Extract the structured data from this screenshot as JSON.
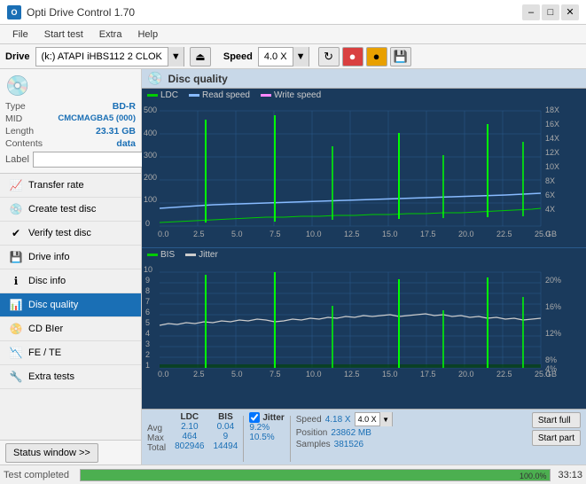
{
  "titleBar": {
    "title": "Opti Drive Control 1.70",
    "minimizeLabel": "–",
    "maximizeLabel": "□",
    "closeLabel": "✕"
  },
  "menuBar": {
    "items": [
      "File",
      "Start test",
      "Extra",
      "Help"
    ]
  },
  "driveBar": {
    "driveLabel": "Drive",
    "driveValue": "(k:) ATAPI iHBS112  2 CLOK",
    "speedLabel": "Speed",
    "speedValue": "4.0 X",
    "ejectIcon": "⏏"
  },
  "disc": {
    "type_label": "Type",
    "type_value": "BD-R",
    "mid_label": "MID",
    "mid_value": "CMCMAGBA5 (000)",
    "length_label": "Length",
    "length_value": "23.31 GB",
    "contents_label": "Contents",
    "contents_value": "data",
    "label_label": "Label",
    "label_placeholder": ""
  },
  "navItems": [
    {
      "id": "transfer-rate",
      "label": "Transfer rate",
      "icon": "📈"
    },
    {
      "id": "create-test-disc",
      "label": "Create test disc",
      "icon": "💿"
    },
    {
      "id": "verify-test-disc",
      "label": "Verify test disc",
      "icon": "✔"
    },
    {
      "id": "drive-info",
      "label": "Drive info",
      "icon": "💾"
    },
    {
      "id": "disc-info",
      "label": "Disc info",
      "icon": "ℹ"
    },
    {
      "id": "disc-quality",
      "label": "Disc quality",
      "icon": "📊",
      "active": true
    },
    {
      "id": "cd-bier",
      "label": "CD BIer",
      "icon": "📀"
    },
    {
      "id": "fe-te",
      "label": "FE / TE",
      "icon": "📉"
    },
    {
      "id": "extra-tests",
      "label": "Extra tests",
      "icon": "🔧"
    }
  ],
  "discQuality": {
    "title": "Disc quality",
    "icon": "💿",
    "legend_top": [
      "LDC",
      "Read speed",
      "Write speed"
    ],
    "legend_bottom": [
      "BIS",
      "Jitter"
    ],
    "topChart": {
      "yMax": 500,
      "yTicks": [
        0,
        100,
        200,
        300,
        400,
        500
      ],
      "yRightTicks": [
        4,
        6,
        8,
        10,
        12,
        14,
        16,
        18
      ],
      "xMax": 25,
      "xTicks": [
        0,
        2.5,
        5.0,
        7.5,
        10.0,
        12.5,
        15.0,
        17.5,
        20.0,
        22.5,
        25.0
      ],
      "xLabel": "GB"
    },
    "bottomChart": {
      "yMax": 10,
      "yTicks": [
        1,
        2,
        3,
        4,
        5,
        6,
        7,
        8,
        9,
        10
      ],
      "yRightTicks": [
        4,
        8,
        12,
        16,
        20
      ],
      "xMax": 25,
      "xTicks": [
        0,
        2.5,
        5.0,
        7.5,
        10.0,
        12.5,
        15.0,
        17.5,
        20.0,
        22.5,
        25.0
      ],
      "xLabel": "GB"
    }
  },
  "stats": {
    "columns": [
      "LDC",
      "BIS"
    ],
    "jitterLabel": "Jitter",
    "jitterChecked": true,
    "rows": [
      {
        "label": "Avg",
        "ldc": "2.10",
        "bis": "0.04",
        "jitter": "9.2%"
      },
      {
        "label": "Max",
        "ldc": "464",
        "bis": "9",
        "jitter": "10.5%"
      },
      {
        "label": "Total",
        "ldc": "802946",
        "bis": "14494",
        "jitter": ""
      }
    ],
    "speedLabel": "Speed",
    "speedValue": "4.18 X",
    "speedDropdownValue": "4.0 X",
    "positionLabel": "Position",
    "positionValue": "23862 MB",
    "samplesLabel": "Samples",
    "samplesValue": "381526",
    "startFullLabel": "Start full",
    "startPartLabel": "Start part"
  },
  "statusBar": {
    "windowBtnLabel": "Status window >>",
    "progressValue": 100,
    "progressText": "100.0%",
    "timeText": "33:13",
    "statusText": "Test completed"
  },
  "colors": {
    "accent": "#1a6fb5",
    "chartBg": "#1a3a5c",
    "ldcColor": "#00cc00",
    "readColor": "#88bbff",
    "writeColor": "#ff88ff",
    "bisColor": "#00cc00",
    "jitterColor": "#cccccc",
    "spikeColor": "#00ff00"
  }
}
